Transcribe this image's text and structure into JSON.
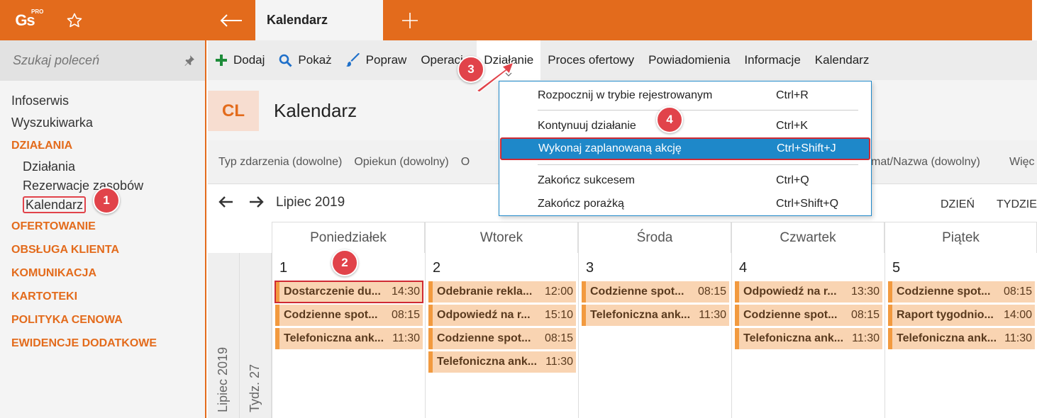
{
  "app": {
    "logo_text": "Gs",
    "logo_sup": "PRO",
    "active_tab": "Kalendarz",
    "brand_color": "#e36b1c"
  },
  "sidebar": {
    "search_placeholder": "Szukaj poleceń",
    "items": [
      {
        "type": "item",
        "label": "Infoserwis"
      },
      {
        "type": "item",
        "label": "Wyszukiwarka"
      },
      {
        "type": "section",
        "label": "DZIAŁANIA"
      },
      {
        "type": "sub",
        "label": "Działania"
      },
      {
        "type": "sub",
        "label": "Rezerwacje zasobów"
      },
      {
        "type": "sub",
        "label": "Kalendarz",
        "selected": true
      },
      {
        "type": "section",
        "label": "OFERTOWANIE"
      },
      {
        "type": "section",
        "label": "OBSŁUGA KLIENTA"
      },
      {
        "type": "section",
        "label": "KOMUNIKACJA"
      },
      {
        "type": "section",
        "label": "KARTOTEKI"
      },
      {
        "type": "section",
        "label": "POLITYKA CENOWA"
      },
      {
        "type": "section",
        "label": "EWIDENCJE DODATKOWE"
      }
    ]
  },
  "toolbar": {
    "add": "Dodaj",
    "show": "Pokaż",
    "edit": "Popraw",
    "operations": "Operacje",
    "action": "Działanie",
    "offer_process": "Proces ofertowy",
    "notifications": "Powiadomienia",
    "information": "Informacje",
    "calendar": "Kalendarz"
  },
  "header": {
    "badge": "CL",
    "title": "Kalendarz"
  },
  "filters": {
    "event_type": "Typ zdarzenia (dowolne)",
    "guardian": "Opiekun (dowolny)",
    "partial": "O",
    "subject": "mat/Nazwa (dowolny)",
    "more": "Więc"
  },
  "calendar_nav": {
    "month": "Lipiec 2019",
    "view_day": "DZIEŃ",
    "view_week": "TYDZIE"
  },
  "calendar": {
    "month_vertical": "Lipiec 2019",
    "week_vertical": "Tydz. 27",
    "days": [
      {
        "name": "Poniedziałek",
        "num": "1",
        "events": [
          {
            "title": "Dostarczenie du...",
            "time": "14:30",
            "highlight": true
          },
          {
            "title": "Codzienne spot...",
            "time": "08:15"
          },
          {
            "title": "Telefoniczna ank...",
            "time": "11:30"
          }
        ]
      },
      {
        "name": "Wtorek",
        "num": "2",
        "events": [
          {
            "title": "Odebranie rekla...",
            "time": "12:00"
          },
          {
            "title": "Odpowiedź na r...",
            "time": "15:10"
          },
          {
            "title": "Codzienne spot...",
            "time": "08:15"
          },
          {
            "title": "Telefoniczna ank...",
            "time": "11:30"
          }
        ]
      },
      {
        "name": "Środa",
        "num": "3",
        "events": [
          {
            "title": "Codzienne spot...",
            "time": "08:15"
          },
          {
            "title": "Telefoniczna ank...",
            "time": "11:30"
          }
        ]
      },
      {
        "name": "Czwartek",
        "num": "4",
        "events": [
          {
            "title": "Odpowiedź na r...",
            "time": "13:30"
          },
          {
            "title": "Codzienne spot...",
            "time": "08:15"
          },
          {
            "title": "Telefoniczna ank...",
            "time": "11:30"
          }
        ]
      },
      {
        "name": "Piątek",
        "num": "5",
        "events": [
          {
            "title": "Codzienne spot...",
            "time": "08:15"
          },
          {
            "title": "Raport tygodnio...",
            "time": "14:00"
          },
          {
            "title": "Telefoniczna ank...",
            "time": "11:30"
          }
        ]
      }
    ]
  },
  "dropdown": {
    "items": [
      {
        "label": "Rozpocznij w trybie rejestrowanym",
        "shortcut": "Ctrl+R"
      },
      {
        "label": "Kontynuuj działanie",
        "shortcut": "Ctrl+K"
      },
      {
        "label": "Wykonaj zaplanowaną akcję",
        "shortcut": "Ctrl+Shift+J",
        "selected": true
      },
      {
        "label": "Zakończ sukcesem",
        "shortcut": "Ctrl+Q"
      },
      {
        "label": "Zakończ porażką",
        "shortcut": "Ctrl+Shift+Q"
      }
    ]
  },
  "callouts": [
    "1",
    "2",
    "3",
    "4"
  ]
}
